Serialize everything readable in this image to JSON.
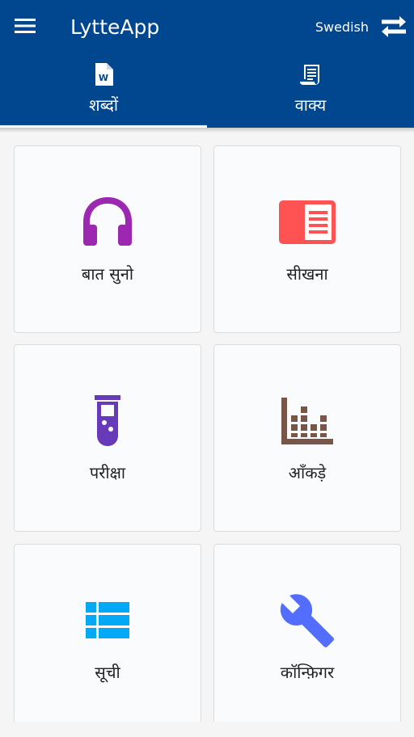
{
  "app_bar": {
    "title": "LytteApp",
    "language": "Swedish",
    "menu_icon": "hamburger-menu-icon",
    "swap_icon": "swap-arrows-icon",
    "background": "#01478f"
  },
  "tabs": [
    {
      "label": "शब्दों",
      "icon": "word-document-icon",
      "selected": true
    },
    {
      "label": "वाक्य",
      "icon": "scroll-document-icon",
      "selected": false
    }
  ],
  "cards": [
    {
      "label": "बात सुनो",
      "icon": "headphones-icon",
      "color": "#9c27b0"
    },
    {
      "label": "सीखना",
      "icon": "chrome-reader-icon",
      "color": "#ff5252"
    },
    {
      "label": "परीक्षा",
      "icon": "test-tube-icon",
      "color": "#673ab7"
    },
    {
      "label": "आँकड़े",
      "icon": "bar-stats-icon",
      "color": "#795548"
    },
    {
      "label": "सूची",
      "icon": "list-view-icon",
      "color": "#03a9f4"
    },
    {
      "label": "कॉन्फ़िगर",
      "icon": "wrench-icon",
      "color": "#536dfe"
    }
  ]
}
